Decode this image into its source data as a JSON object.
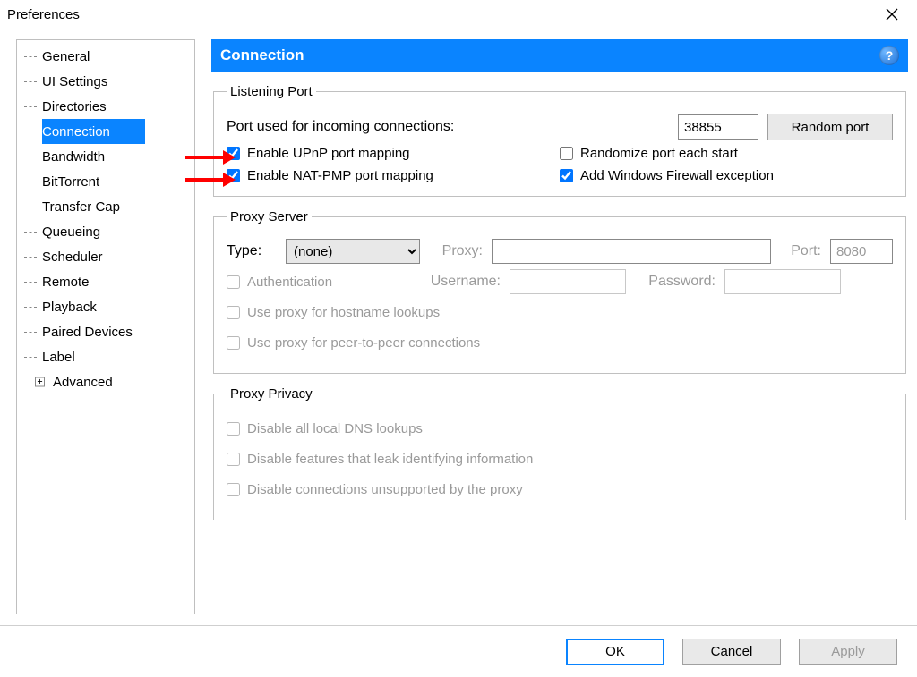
{
  "window": {
    "title": "Preferences"
  },
  "sidebar": {
    "items": [
      {
        "label": "General"
      },
      {
        "label": "UI Settings"
      },
      {
        "label": "Directories"
      },
      {
        "label": "Connection",
        "selected": true
      },
      {
        "label": "Bandwidth"
      },
      {
        "label": "BitTorrent"
      },
      {
        "label": "Transfer Cap"
      },
      {
        "label": "Queueing"
      },
      {
        "label": "Scheduler"
      },
      {
        "label": "Remote"
      },
      {
        "label": "Playback"
      },
      {
        "label": "Paired Devices"
      },
      {
        "label": "Label"
      },
      {
        "label": "Advanced",
        "expandable": true
      }
    ]
  },
  "panel": {
    "header": "Connection"
  },
  "listening_port": {
    "legend": "Listening Port",
    "port_label": "Port used for incoming connections:",
    "port_value": "38855",
    "random_button": "Random port",
    "upnp_label": "Enable UPnP port mapping",
    "upnp_checked": true,
    "randomize_label": "Randomize port each start",
    "randomize_checked": false,
    "natpmp_label": "Enable NAT-PMP port mapping",
    "natpmp_checked": true,
    "firewall_label": "Add Windows Firewall exception",
    "firewall_checked": true
  },
  "proxy_server": {
    "legend": "Proxy Server",
    "type_label": "Type:",
    "type_value": "(none)",
    "proxy_label": "Proxy:",
    "proxy_value": "",
    "port_label": "Port:",
    "port_value": "8080",
    "auth_label": "Authentication",
    "user_label": "Username:",
    "pass_label": "Password:",
    "hostname_label": "Use proxy for hostname lookups",
    "p2p_label": "Use proxy for peer-to-peer connections"
  },
  "proxy_privacy": {
    "legend": "Proxy Privacy",
    "dns_label": "Disable all local DNS lookups",
    "leak_label": "Disable features that leak identifying information",
    "unsupported_label": "Disable connections unsupported by the proxy"
  },
  "buttons": {
    "ok": "OK",
    "cancel": "Cancel",
    "apply": "Apply"
  }
}
